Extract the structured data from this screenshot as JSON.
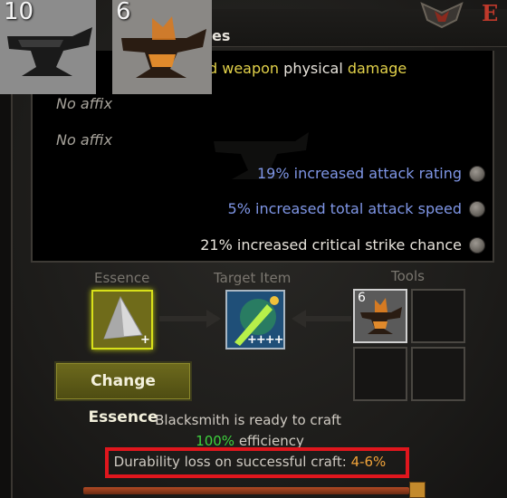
{
  "header": {
    "title_partial": "es",
    "corner_title_partial": "E",
    "brand_color": "#c0392b"
  },
  "affixes": {
    "line1": {
      "part_a": "d ",
      "part_b": "weapon",
      "part_c": " physical ",
      "part_d": "damage"
    },
    "no_affix_1": "No affix",
    "no_affix_2": "No affix",
    "blue_1": "19% increased attack rating",
    "blue_2": "5% increased total attack speed",
    "white_1": "21% increased critical strike chance",
    "colors": {
      "magic": "#7f96e6",
      "rare": "#e3d24a",
      "normal": "#e8e4dc"
    }
  },
  "inventory_thumbs": [
    {
      "count": "10",
      "item": "anvil-icon"
    },
    {
      "count": "6",
      "item": "glowing-anvil-icon"
    }
  ],
  "crafting": {
    "essence_label": "Essence",
    "target_label": "Target Item",
    "tools_label": "Tools",
    "essence_plus": "+",
    "target_plus": "++++",
    "tool_count": "6",
    "change_essence": "Change Essence"
  },
  "status": {
    "ready": "Blacksmith is ready to craft",
    "efficiency_value": "100%",
    "efficiency_label": " efficiency",
    "durability_label": "Durability loss on successful craft: ",
    "durability_value": "4-6%"
  }
}
